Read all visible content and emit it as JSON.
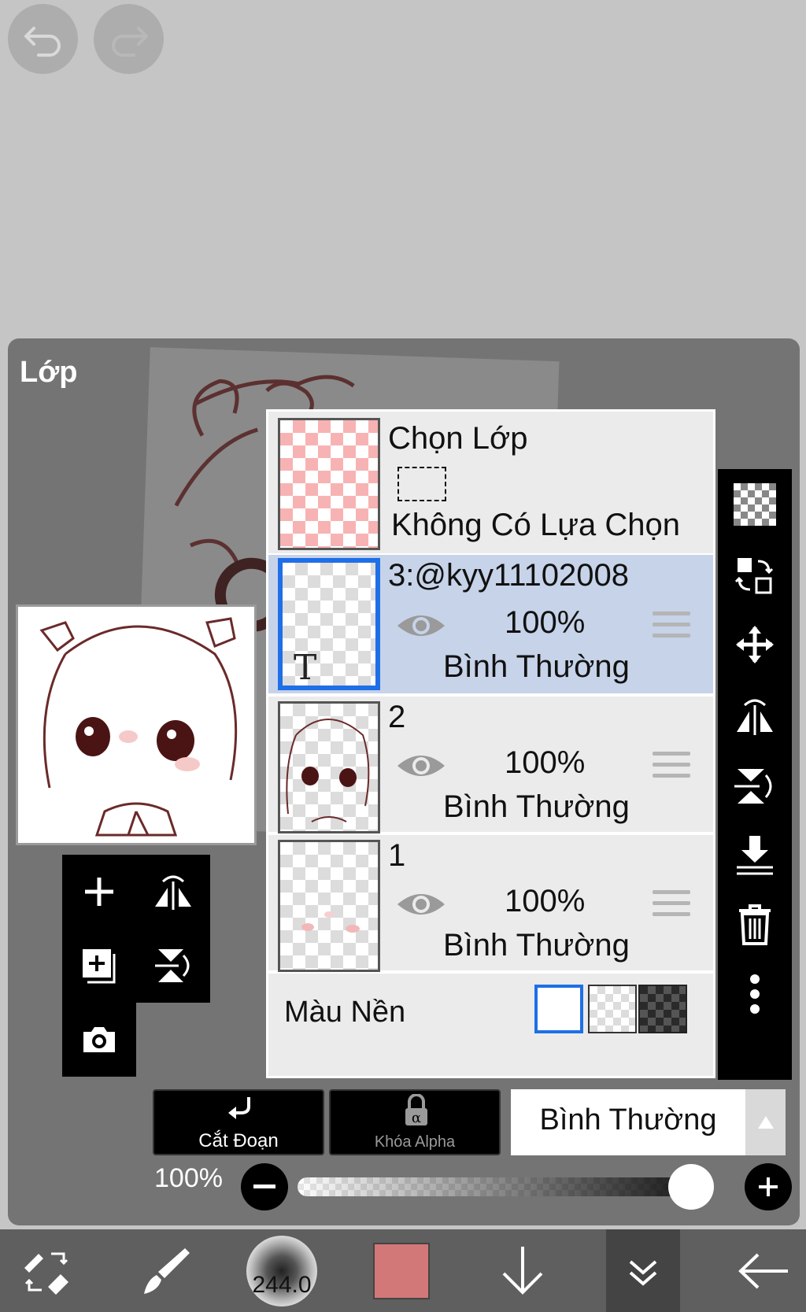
{
  "panel": {
    "title": "Lớp"
  },
  "selection_layer": {
    "title": "Chọn Lớp",
    "subtitle": "Không Có Lựa Chọn"
  },
  "layers": [
    {
      "name": "3:@kyy11102008",
      "opacity": "100%",
      "blend": "Bình Thường",
      "selected": true,
      "thumb_glyph": "T"
    },
    {
      "name": "2",
      "opacity": "100%",
      "blend": "Bình Thường",
      "selected": false
    },
    {
      "name": "1",
      "opacity": "100%",
      "blend": "Bình Thường",
      "selected": false
    }
  ],
  "background": {
    "label": "Màu Nền"
  },
  "actions": {
    "clipping": "Cắt Đoạn",
    "alpha_lock": "Khóa Alpha",
    "blend_mode": "Bình Thường"
  },
  "opacity_slider": {
    "label": "100%",
    "value": 1.0
  },
  "toolbar": {
    "brush_size": "244.0",
    "color": "#d27878"
  },
  "colors": {
    "selection_blue": "#1f6fe6",
    "selected_row": "#c6d3e9",
    "panel_bg": "#747474",
    "app_bg": "#c5c5c5"
  }
}
